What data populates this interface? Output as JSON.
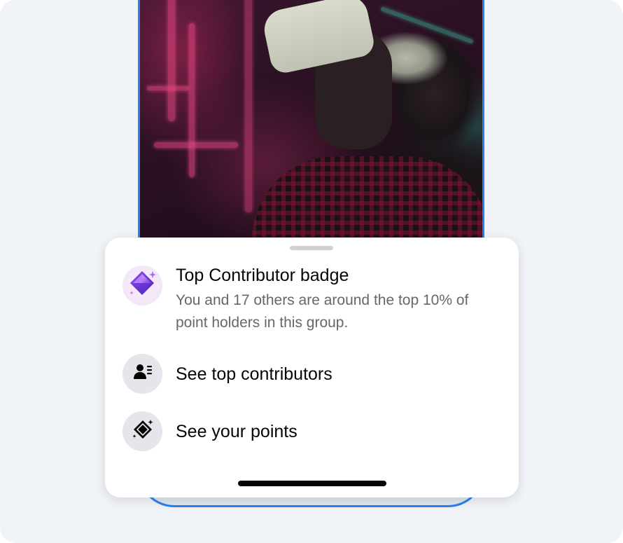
{
  "badge_panel": {
    "title": "Top Contributor badge",
    "description": "You and 17 others are around the top 10% of point holders in this group.",
    "icon": "purple-diamond-badge-icon",
    "accent_color": "#9b51e0"
  },
  "actions": [
    {
      "label": "See top contributors",
      "icon": "person-list-icon"
    },
    {
      "label": "See your points",
      "icon": "diamond-sparkle-icon"
    }
  ],
  "colors": {
    "frame_accent": "#2d7ef3",
    "sheet_background": "#ffffff",
    "icon_circle": "#e4e6eb",
    "secondary_text": "#65676b"
  }
}
